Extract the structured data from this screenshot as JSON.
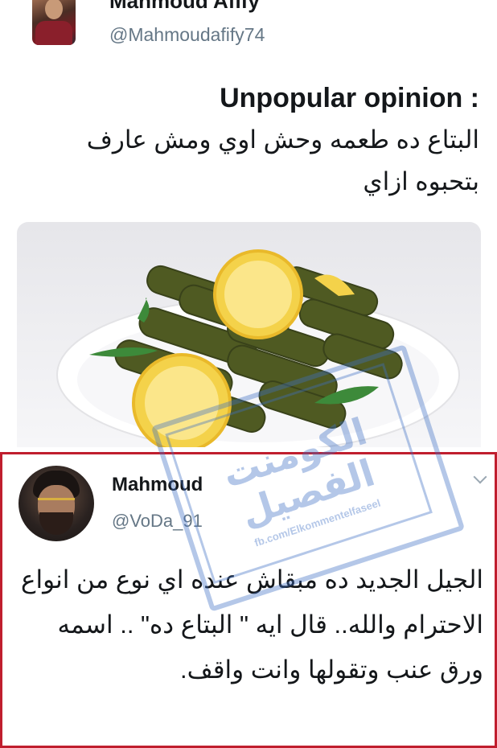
{
  "tweet1": {
    "name": "Mahmoud Afify",
    "handle": "@Mahmoudafify74",
    "heading": "Unpopular opinion :",
    "body": "البتاع ده طعمه وحش اوي ومش عارف بتحبوه ازاي"
  },
  "tweet2": {
    "name": "Mahmoud",
    "handle": "@VoDa_91",
    "body": "الجيل الجديد ده مبقاش عنده اي نوع من انواع الاحترام والله.. قال ايه \" البتاع ده\" .. اسمه ورق عنب وتقولها وانت واقف."
  },
  "watermark": {
    "text": "الكومنت الفصيل",
    "url": "fb.com/Elkommentelfaseel"
  },
  "colors": {
    "highlight_border": "#c01e2e",
    "handle": "#657786",
    "watermark": "#3d6fc4"
  }
}
